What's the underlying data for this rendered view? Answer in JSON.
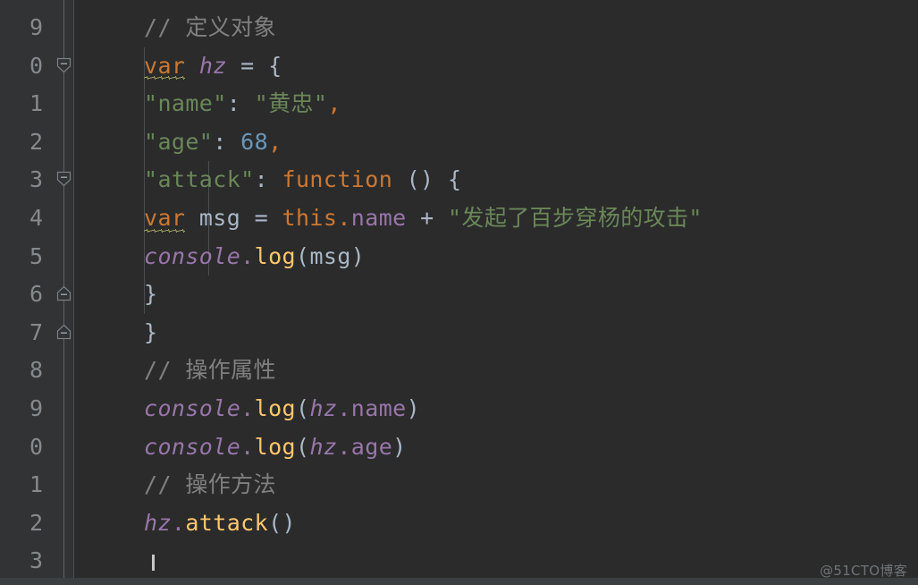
{
  "app": {
    "kind": "code-editor",
    "language": "JavaScript",
    "theme": "Darcula",
    "background": "#2b2b2b",
    "gutter_background": "#313335",
    "default_text_color": "#a9b7c6"
  },
  "palette": {
    "comment": "#808080",
    "keyword": "#cc7832",
    "string": "#6a8759",
    "number": "#6897bb",
    "function": "#ffc66d",
    "property": "#9876aa",
    "punctuation": "#a9b7c6",
    "line_number": "#868a8c",
    "squiggle": "#b5b56a"
  },
  "gutter": {
    "line_numbers": [
      "9",
      "0",
      "1",
      "2",
      "3",
      "4",
      "5",
      "6",
      "7",
      "8",
      "9",
      "0",
      "1",
      "2",
      "3"
    ],
    "fold_markers": [
      {
        "row": 1,
        "type": "fold-open-start"
      },
      {
        "row": 4,
        "type": "fold-open-start"
      },
      {
        "row": 7,
        "type": "fold-open-end"
      },
      {
        "row": 8,
        "type": "fold-open-end"
      }
    ]
  },
  "code": {
    "lines": [
      {
        "n": "9",
        "indent": 0,
        "tokens": [
          {
            "text": "// 定义对象",
            "cls": "t-comment"
          }
        ]
      },
      {
        "n": "0",
        "indent": 0,
        "tokens": [
          {
            "text": "var",
            "cls": "t-kw",
            "squiggle": true
          },
          {
            "text": " ",
            "cls": "t-punc"
          },
          {
            "text": "hz",
            "cls": "t-obj"
          },
          {
            "text": " ",
            "cls": "t-punc"
          },
          {
            "text": "=",
            "cls": "t-punc"
          },
          {
            "text": " ",
            "cls": "t-punc"
          },
          {
            "text": "{",
            "cls": "t-brace"
          }
        ]
      },
      {
        "n": "1",
        "indent": 1,
        "tokens": [
          {
            "text": "    ",
            "cls": "t-punc"
          },
          {
            "text": "\"name\"",
            "cls": "t-str"
          },
          {
            "text": ":",
            "cls": "t-colon"
          },
          {
            "text": " ",
            "cls": "t-punc"
          },
          {
            "text": "\"黄忠\"",
            "cls": "t-str"
          },
          {
            "text": ",",
            "cls": "t-comma"
          }
        ]
      },
      {
        "n": "2",
        "indent": 1,
        "tokens": [
          {
            "text": "    ",
            "cls": "t-punc"
          },
          {
            "text": "\"age\"",
            "cls": "t-str"
          },
          {
            "text": ":",
            "cls": "t-colon"
          },
          {
            "text": " ",
            "cls": "t-punc"
          },
          {
            "text": "68",
            "cls": "t-num"
          },
          {
            "text": ",",
            "cls": "t-comma"
          }
        ]
      },
      {
        "n": "3",
        "indent": 1,
        "tokens": [
          {
            "text": "    ",
            "cls": "t-punc"
          },
          {
            "text": "\"attack\"",
            "cls": "t-str"
          },
          {
            "text": ":",
            "cls": "t-colon"
          },
          {
            "text": " ",
            "cls": "t-punc"
          },
          {
            "text": "function",
            "cls": "t-kw"
          },
          {
            "text": " ",
            "cls": "t-punc"
          },
          {
            "text": "()",
            "cls": "t-brace"
          },
          {
            "text": " ",
            "cls": "t-punc"
          },
          {
            "text": "{",
            "cls": "t-brace"
          }
        ]
      },
      {
        "n": "4",
        "indent": 2,
        "tokens": [
          {
            "text": "        ",
            "cls": "t-punc"
          },
          {
            "text": "var",
            "cls": "t-kw",
            "squiggle": true
          },
          {
            "text": " ",
            "cls": "t-punc"
          },
          {
            "text": "msg",
            "cls": "t-ident"
          },
          {
            "text": " ",
            "cls": "t-punc"
          },
          {
            "text": "=",
            "cls": "t-punc"
          },
          {
            "text": " ",
            "cls": "t-punc"
          },
          {
            "text": "this",
            "cls": "t-kw"
          },
          {
            "text": ".",
            "cls": "t-kw"
          },
          {
            "text": "name",
            "cls": "t-prop"
          },
          {
            "text": " ",
            "cls": "t-punc"
          },
          {
            "text": "+",
            "cls": "t-punc"
          },
          {
            "text": " ",
            "cls": "t-punc"
          },
          {
            "text": "\"发起了百步穿杨的攻击\"",
            "cls": "t-str"
          }
        ]
      },
      {
        "n": "5",
        "indent": 2,
        "tokens": [
          {
            "text": "        ",
            "cls": "t-punc"
          },
          {
            "text": "console",
            "cls": "t-var"
          },
          {
            "text": ".",
            "cls": "t-dot"
          },
          {
            "text": "log",
            "cls": "t-fn"
          },
          {
            "text": "(",
            "cls": "t-brace"
          },
          {
            "text": "msg",
            "cls": "t-ident"
          },
          {
            "text": ")",
            "cls": "t-brace"
          }
        ]
      },
      {
        "n": "6",
        "indent": 1,
        "tokens": [
          {
            "text": "    ",
            "cls": "t-punc"
          },
          {
            "text": "}",
            "cls": "t-brace"
          }
        ]
      },
      {
        "n": "7",
        "indent": 0,
        "tokens": [
          {
            "text": "}",
            "cls": "t-brace"
          }
        ]
      },
      {
        "n": "8",
        "indent": 0,
        "tokens": [
          {
            "text": "// 操作属性",
            "cls": "t-comment"
          }
        ]
      },
      {
        "n": "9",
        "indent": 0,
        "tokens": [
          {
            "text": "console",
            "cls": "t-var"
          },
          {
            "text": ".",
            "cls": "t-dot"
          },
          {
            "text": "log",
            "cls": "t-fn"
          },
          {
            "text": "(",
            "cls": "t-brace"
          },
          {
            "text": "hz",
            "cls": "t-obj"
          },
          {
            "text": ".",
            "cls": "t-dot"
          },
          {
            "text": "name",
            "cls": "t-prop"
          },
          {
            "text": ")",
            "cls": "t-brace"
          }
        ]
      },
      {
        "n": "0",
        "indent": 0,
        "tokens": [
          {
            "text": "console",
            "cls": "t-var"
          },
          {
            "text": ".",
            "cls": "t-dot"
          },
          {
            "text": "log",
            "cls": "t-fn"
          },
          {
            "text": "(",
            "cls": "t-brace"
          },
          {
            "text": "hz",
            "cls": "t-obj"
          },
          {
            "text": ".",
            "cls": "t-dot"
          },
          {
            "text": "age",
            "cls": "t-prop"
          },
          {
            "text": ")",
            "cls": "t-brace"
          }
        ]
      },
      {
        "n": "1",
        "indent": 0,
        "tokens": [
          {
            "text": "// 操作方法",
            "cls": "t-comment"
          }
        ]
      },
      {
        "n": "2",
        "indent": 0,
        "tokens": [
          {
            "text": "hz",
            "cls": "t-obj"
          },
          {
            "text": ".",
            "cls": "t-dot"
          },
          {
            "text": "attack",
            "cls": "t-fn"
          },
          {
            "text": "(",
            "cls": "t-brace"
          },
          {
            "text": ")",
            "cls": "t-brace"
          }
        ]
      },
      {
        "n": "3",
        "indent": 0,
        "tokens": []
      }
    ]
  },
  "watermark": {
    "text": "@51CTO博客"
  }
}
